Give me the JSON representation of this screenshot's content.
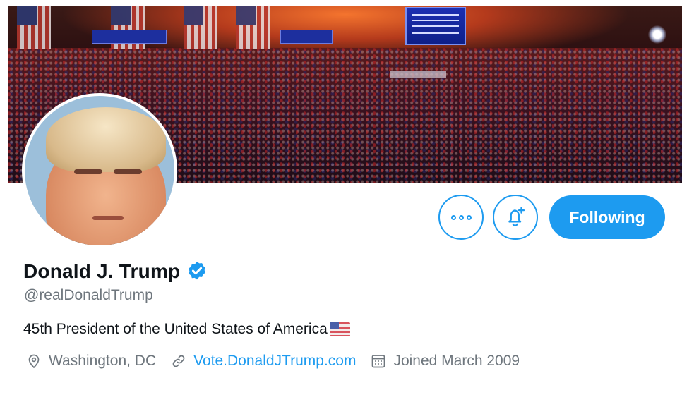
{
  "profile": {
    "name": "Donald J. Trump",
    "handle": "@realDonaldTrump",
    "bio": "45th President of the United States of America",
    "location": "Washington, DC",
    "website": "Vote.DonaldJTrump.com",
    "joined": "Joined March 2009"
  },
  "buttons": {
    "following_label": "Following"
  },
  "icons": {
    "more": "more-options-icon",
    "notify": "bell-plus-icon",
    "verified": "verified-badge-icon",
    "location": "location-pin-icon",
    "link": "link-icon",
    "calendar": "calendar-icon",
    "flag": "us-flag-emoji-icon"
  },
  "colors": {
    "accent": "#1d9bf0",
    "text_primary": "#0f1419",
    "text_secondary": "#6e767d",
    "background": "#ffffff"
  }
}
